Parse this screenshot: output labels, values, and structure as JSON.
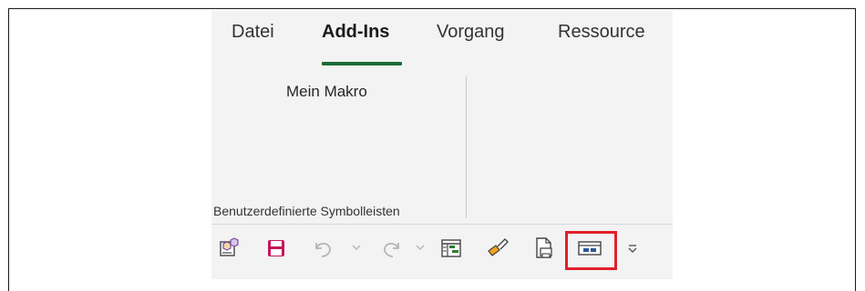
{
  "ribbon": {
    "tabs": [
      {
        "label": "Datei",
        "active": false
      },
      {
        "label": "Add-Ins",
        "active": true
      },
      {
        "label": "Vorgang",
        "active": false
      },
      {
        "label": "Ressource",
        "active": false
      }
    ],
    "macro_button": "Mein Makro",
    "group_label": "Benutzerdefinierte Symbolleisten"
  },
  "quick_access_toolbar": {
    "buttons": [
      {
        "name": "project-cubes-icon"
      },
      {
        "name": "save-icon"
      },
      {
        "name": "undo-icon"
      },
      {
        "name": "redo-icon"
      },
      {
        "name": "gantt-view-icon"
      },
      {
        "name": "format-painter-icon"
      },
      {
        "name": "print-preview-icon"
      },
      {
        "name": "toolbar-icon",
        "highlighted": true
      },
      {
        "name": "customize-qat-icon"
      }
    ]
  },
  "colors": {
    "accent_underline": "#1e6b34",
    "save_icon": "#c2185b",
    "highlight_border": "#e0202a",
    "toolbar_icon": "#2b5797"
  }
}
